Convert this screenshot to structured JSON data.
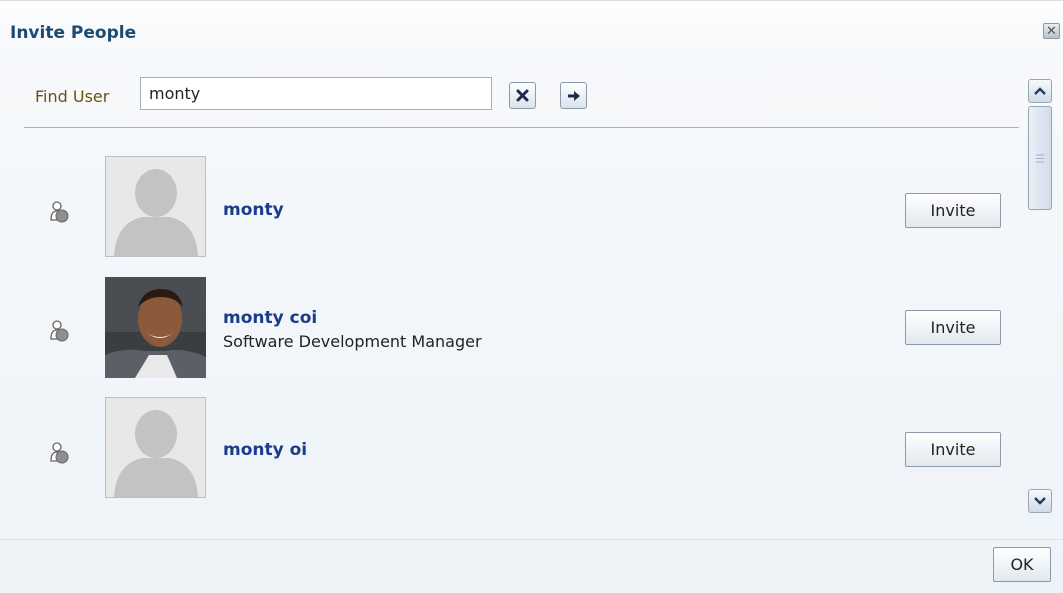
{
  "dialog": {
    "title": "Invite People",
    "close_icon": "close-icon"
  },
  "search": {
    "label": "Find User",
    "value": "monty",
    "clear_icon": "clear-x-icon",
    "go_icon": "arrow-right-icon"
  },
  "results": [
    {
      "name": "monty",
      "title": "",
      "photo": "placeholder-silhouette",
      "presence_icon": "presence-offline-icon",
      "action": "Invite"
    },
    {
      "name": "monty coi",
      "title": "Software Development Manager",
      "photo": "user-photo",
      "presence_icon": "presence-offline-icon",
      "action": "Invite"
    },
    {
      "name": "monty oi",
      "title": "",
      "photo": "placeholder-silhouette",
      "presence_icon": "presence-offline-icon",
      "action": "Invite"
    }
  ],
  "scrollbar": {
    "up_icon": "chevron-up-icon",
    "down_icon": "chevron-down-icon"
  },
  "footer": {
    "ok_label": "OK"
  },
  "colors": {
    "title": "#1b4a73",
    "name_link": "#1a3c8a",
    "find_label": "#6b5214",
    "divider": "#a9b2bc"
  }
}
